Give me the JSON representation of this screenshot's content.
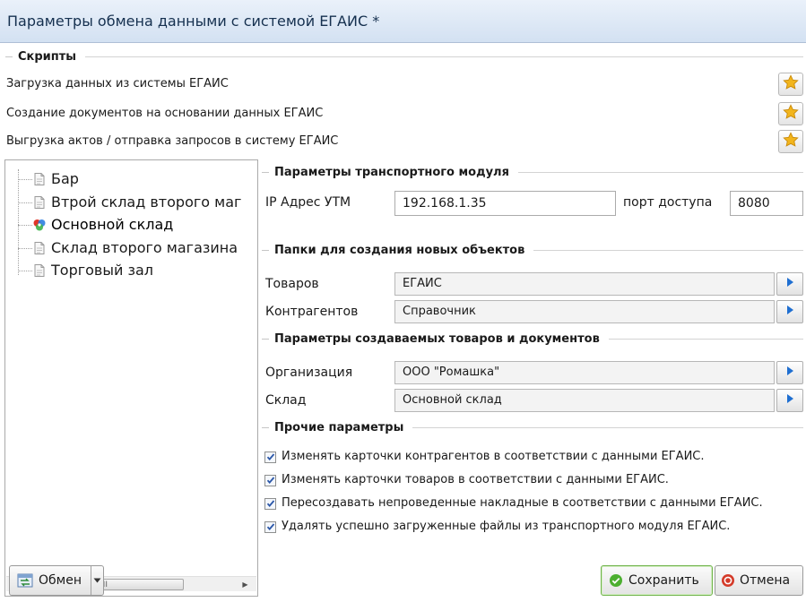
{
  "window": {
    "title": "Параметры обмена данными с системой ЕГАИС *"
  },
  "scripts": {
    "legend": "Скрипты",
    "items": [
      {
        "label": "Загрузка данных из системы ЕГАИС"
      },
      {
        "label": "Создание документов на основании данных ЕГАИС"
      },
      {
        "label": "Выгрузка актов / отправка запросов в систему ЕГАИС"
      }
    ],
    "button_icon": "star-icon"
  },
  "tree": {
    "items": [
      {
        "label": "Бар",
        "icon": "document-icon"
      },
      {
        "label": "Втрой склад второго маг",
        "icon": "document-icon"
      },
      {
        "label": "Основной склад",
        "icon": "colorful-gear-icon",
        "selected": true
      },
      {
        "label": "Склад второго магазина",
        "icon": "document-icon"
      },
      {
        "label": "Торговый зал",
        "icon": "document-icon"
      }
    ],
    "scrollbar_grip": "III"
  },
  "transport": {
    "legend": "Параметры транспортного модуля",
    "ip_label": "IP Адрес УТМ",
    "ip_value": "192.168.1.35",
    "port_label": "порт доступа",
    "port_value": "8080"
  },
  "folders": {
    "legend": "Папки для создания новых объектов",
    "goods_label": "Товаров",
    "goods_value": "ЕГАИС",
    "contractors_label": "Контрагентов",
    "contractors_value": "Справочник"
  },
  "created": {
    "legend": "Параметры создаваемых товаров и документов",
    "org_label": "Организация",
    "org_value": "ООО \"Ромашка\"",
    "warehouse_label": "Склад",
    "warehouse_value": "Основной склад"
  },
  "other": {
    "legend": "Прочие параметры",
    "checks": [
      {
        "label": "Изменять карточки контрагентов в соответствии с данными ЕГАИС.",
        "checked": true
      },
      {
        "label": "Изменять карточки товаров в соответствии с данными ЕГАИС.",
        "checked": true
      },
      {
        "label": "Пересоздавать непроведенные накладные в соответствии с данными ЕГАИС.",
        "checked": true
      },
      {
        "label": "Удалять успешно загруженные файлы из транспортного модуля ЕГАИС.",
        "checked": true
      }
    ]
  },
  "footer": {
    "exchange_label": "Обмен",
    "save_label": "Сохранить",
    "cancel_label": "Отмена"
  },
  "colors": {
    "titlebar": "#d3e1f2",
    "accent_blue": "#1f6fd1",
    "save_green": "#4caf30",
    "cancel_red": "#d43b2a",
    "star": "#f2b51c"
  }
}
